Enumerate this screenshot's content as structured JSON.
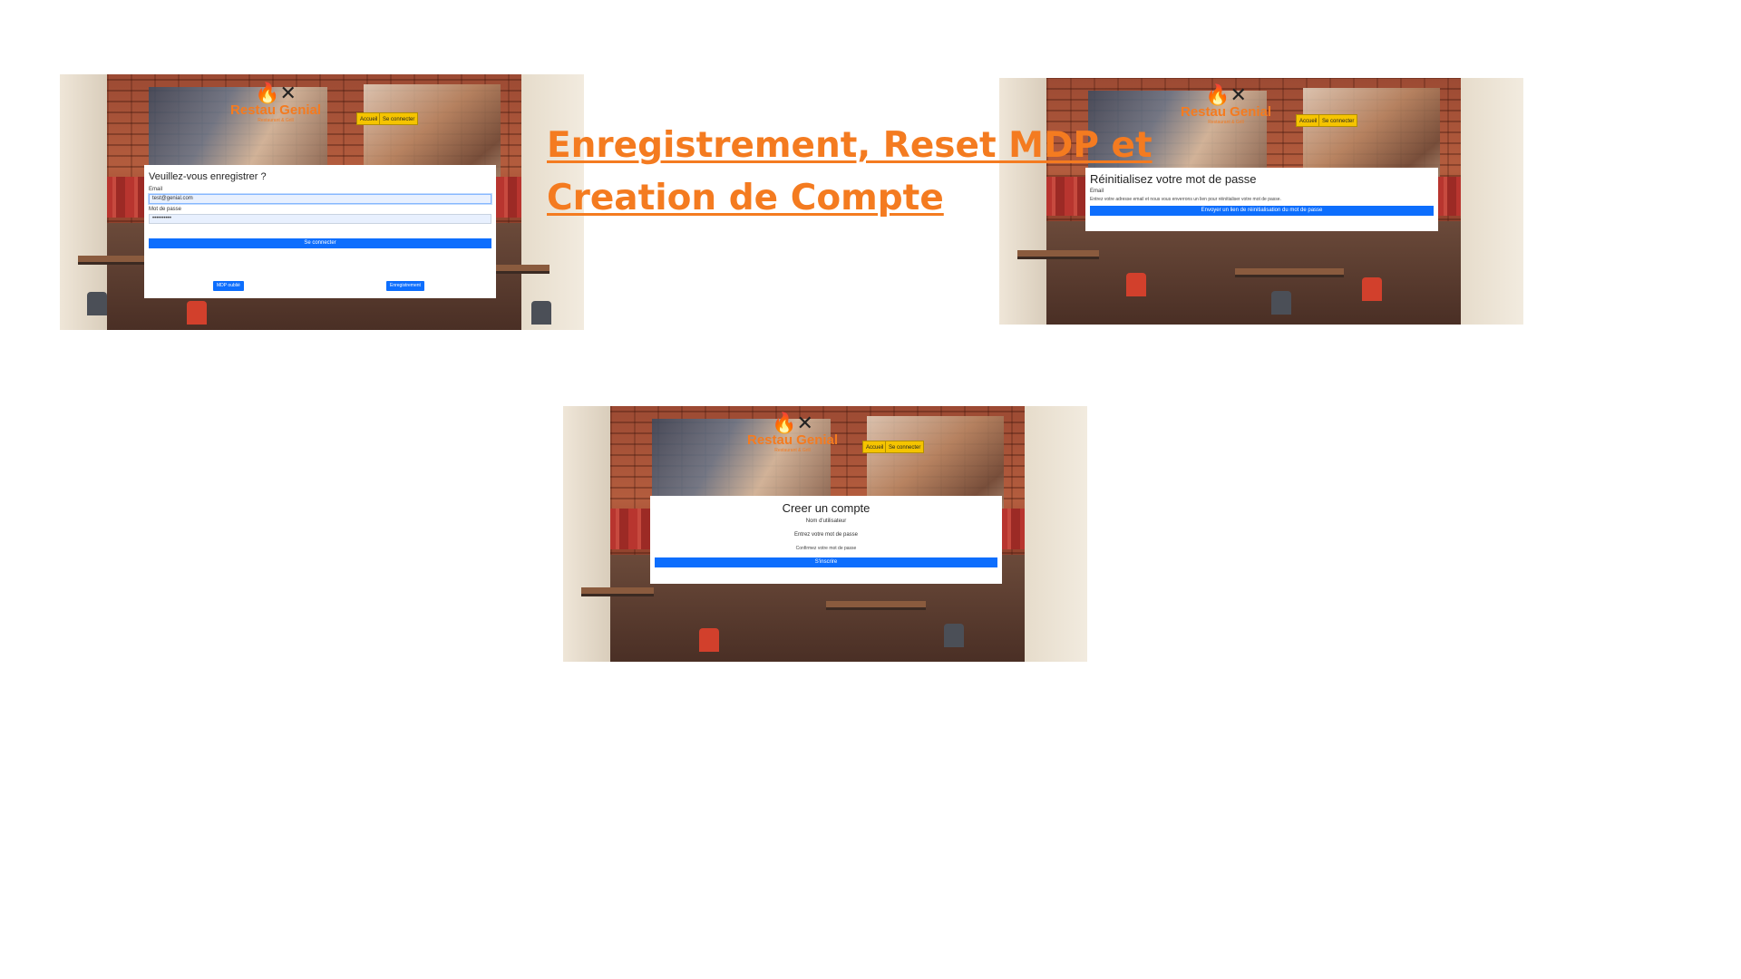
{
  "heading": {
    "line1": "Enregistrement, Reset MDP et",
    "line2": "Creation de Compte"
  },
  "brand": {
    "name": "Restau Genial",
    "tagline": "Restaurant & Grill"
  },
  "nav": {
    "home": "Accueil",
    "login": "Se connecter"
  },
  "login_screen": {
    "title": "Veuillez-vous enregistrer ?",
    "email_label": "Email",
    "email_value": "test@genial.com",
    "password_label": "Mot de passe",
    "password_value": "••••••••••",
    "submit": "Se connecter",
    "forgot_button": "MDP oublié",
    "register_button": "Enregistrement"
  },
  "reset_screen": {
    "title": "Réinitialisez votre mot de passe",
    "email_label": "Email",
    "hint": "Entrez votre adresse email et nous vous enverrons un lien pour réinitialiser votre mot de passe.",
    "submit": "Envoyer un lien de réinitialisation du mot de passe"
  },
  "create_screen": {
    "title": "Creer un compte",
    "username_label": "Nom d'utilisateur",
    "password_label": "Entrez votre mot de passe",
    "confirm_hint": "Confirmez votre mot de passe",
    "submit": "S'inscrire"
  },
  "colors": {
    "accent": "#f47b20",
    "primary": "#0d6efd",
    "nav": "#f5c400"
  }
}
